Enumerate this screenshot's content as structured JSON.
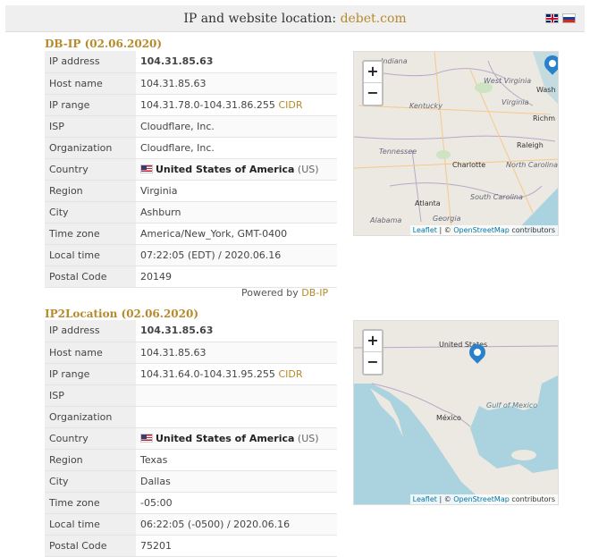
{
  "header": {
    "title_prefix": "IP and website location: ",
    "domain": "debet.com",
    "flags": [
      "flag-uk-icon",
      "flag-ru-icon"
    ]
  },
  "dbip": {
    "title": "DB-IP (02.06.2020)",
    "rows": {
      "ip_label": "IP address",
      "ip": "104.31.85.63",
      "host_label": "Host name",
      "host": "104.31.85.63",
      "range_label": "IP range",
      "range": "104.31.78.0-104.31.86.255",
      "range_link": "CIDR",
      "isp_label": "ISP",
      "isp": "Cloudflare, Inc.",
      "org_label": "Organization",
      "org": "Cloudflare, Inc.",
      "country_label": "Country",
      "country": "United States of America",
      "country_code": "(US)",
      "region_label": "Region",
      "region": "Virginia",
      "city_label": "City",
      "city": "Ashburn",
      "tz_label": "Time zone",
      "tz": "America/New_York, GMT-0400",
      "local_label": "Local time",
      "local": "07:22:05 (EDT) / 2020.06.16",
      "postal_label": "Postal Code",
      "postal": "20149"
    },
    "powered_prefix": "Powered by ",
    "powered_link": "DB-IP",
    "map": {
      "zoom_in": "+",
      "zoom_out": "−",
      "labels": {
        "indiana": "Indiana",
        "west_virginia": "West Virginia",
        "wash": "Wash",
        "virginia": "Virginia",
        "kentucky": "Kentucky",
        "richm": "Richm",
        "tennessee": "Tennessee",
        "raleigh": "Raleigh",
        "charlotte": "Charlotte",
        "north_carolina": "North Carolina",
        "south_carolina": "South Carolina",
        "atlanta": "Atlanta",
        "georgia": "Georgia",
        "alabama": "Alabama"
      },
      "attrib_leaflet": "Leaflet",
      "attrib_sep": " | © ",
      "attrib_osm": "OpenStreetMap",
      "attrib_suffix": " contributors"
    }
  },
  "ip2": {
    "title": "IP2Location (02.06.2020)",
    "rows": {
      "ip_label": "IP address",
      "ip": "104.31.85.63",
      "host_label": "Host name",
      "host": "104.31.85.63",
      "range_label": "IP range",
      "range": "104.31.64.0-104.31.95.255",
      "range_link": "CIDR",
      "isp_label": "ISP",
      "isp": "",
      "org_label": "Organization",
      "org": "",
      "country_label": "Country",
      "country": "United States of America",
      "country_code": "(US)",
      "region_label": "Region",
      "region": "Texas",
      "city_label": "City",
      "city": "Dallas",
      "tz_label": "Time zone",
      "tz": "-05:00",
      "local_label": "Local time",
      "local": "06:22:05 (-0500) / 2020.06.16",
      "postal_label": "Postal Code",
      "postal": "75201"
    },
    "map": {
      "zoom_in": "+",
      "zoom_out": "−",
      "labels": {
        "united_states": "United States",
        "mexico": "México",
        "gulf": "Gulf of Mexico"
      },
      "attrib_leaflet": "Leaflet",
      "attrib_sep": " | © ",
      "attrib_osm": "OpenStreetMap",
      "attrib_suffix": " contributors"
    }
  },
  "colors": {
    "accent": "#b68a2a",
    "label_bg": "#efefef",
    "pin": "#2a81cb",
    "water": "#aad3df",
    "land": "#e8e6e0"
  }
}
